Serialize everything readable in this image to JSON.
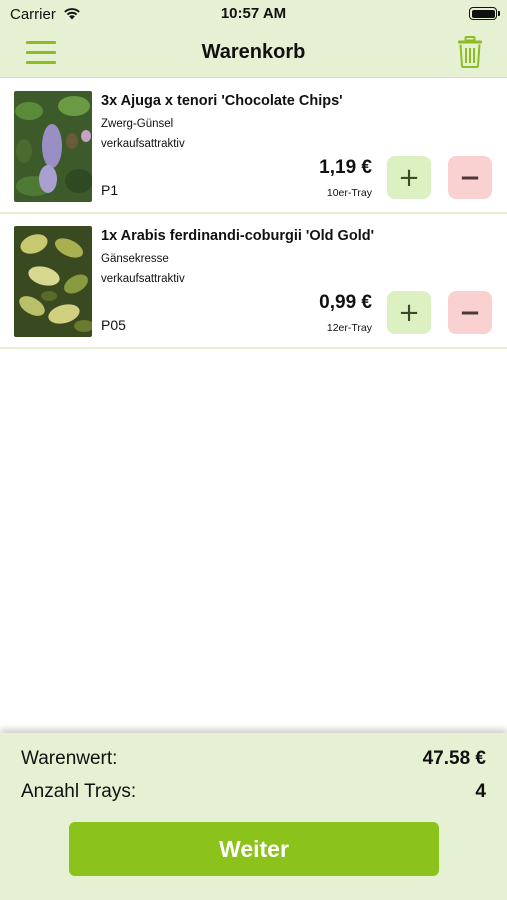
{
  "status_bar": {
    "carrier": "Carrier",
    "time": "10:57 AM"
  },
  "nav": {
    "title": "Warenkorb",
    "menu_icon": "hamburger-menu-icon",
    "trash_icon": "trash-icon"
  },
  "items": [
    {
      "title": "3x Ajuga x tenori 'Chocolate Chips'",
      "subtitle": "Zwerg-Günsel",
      "tag": "verkaufsattraktiv",
      "code": "P1",
      "price": "1,19 €",
      "unit": "10er-Tray",
      "plus_label": "+",
      "minus_label": "−"
    },
    {
      "title": "1x Arabis ferdinandi-coburgii 'Old Gold'",
      "subtitle": "Gänsekresse",
      "tag": "verkaufsattraktiv",
      "code": "P05",
      "price": "0,99 €",
      "unit": "12er-Tray",
      "plus_label": "+",
      "minus_label": "−"
    }
  ],
  "footer": {
    "warenwert_label": "Warenwert:",
    "warenwert_value": "47.58 €",
    "trays_label": "Anzahl Trays:",
    "trays_value": "4",
    "button_label": "Weiter"
  },
  "colors": {
    "accent": "#8cc21c",
    "header_bg": "#e6f0d3",
    "plus_bg": "#dcf0c2",
    "minus_bg": "#f8d1d0"
  }
}
